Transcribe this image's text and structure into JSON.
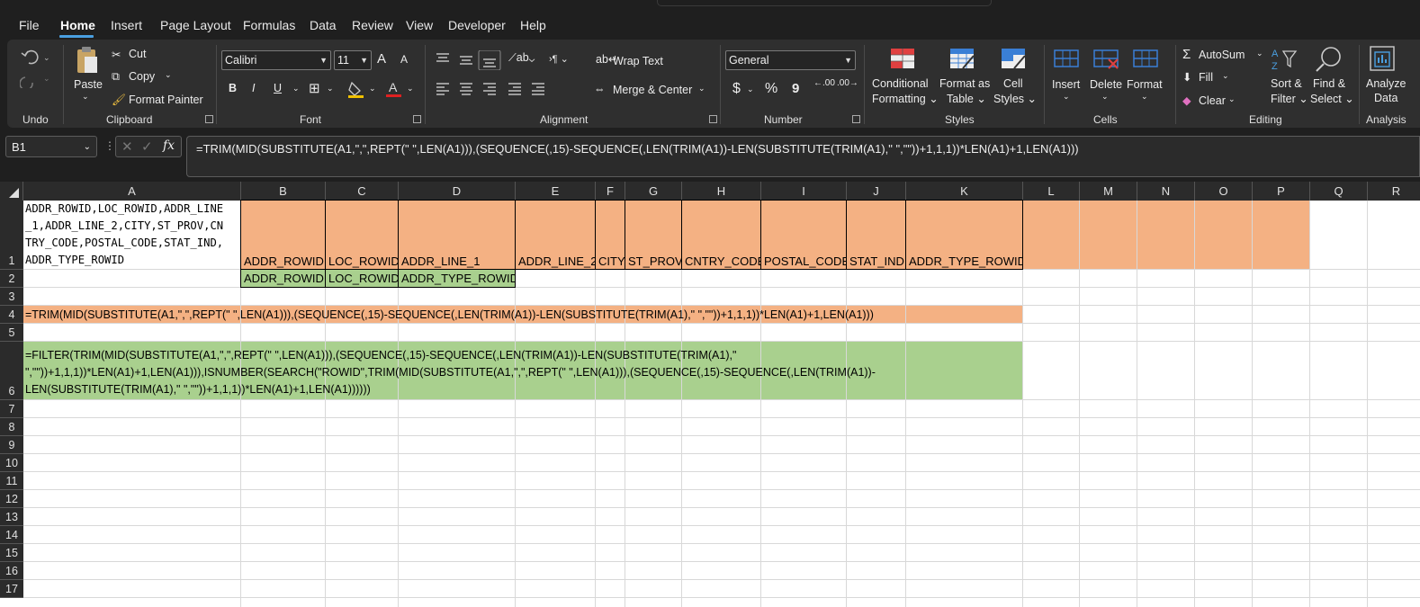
{
  "menu": {
    "items": [
      "File",
      "Home",
      "Insert",
      "Page Layout",
      "Formulas",
      "Data",
      "Review",
      "View",
      "Developer",
      "Help"
    ],
    "active": "Home"
  },
  "ribbon": {
    "undo": {
      "group": "Undo"
    },
    "clipboard": {
      "group": "Clipboard",
      "paste": "Paste",
      "cut": "Cut",
      "copy": "Copy",
      "format_painter": "Format Painter"
    },
    "font": {
      "group": "Font",
      "name": "Calibri",
      "size": "11",
      "grow": "A",
      "shrink": "A",
      "bold": "B",
      "italic": "I",
      "underline": "U"
    },
    "alignment": {
      "group": "Alignment",
      "wrap": "Wrap Text",
      "merge": "Merge & Center"
    },
    "number": {
      "group": "Number",
      "format": "General",
      "currency": "$",
      "percent": "%",
      "comma": "9",
      "inc": ".00",
      "dec": ".00"
    },
    "styles": {
      "group": "Styles",
      "conditional_1": "Conditional",
      "conditional_2": "Formatting",
      "format_table_1": "Format as",
      "format_table_2": "Table",
      "cell_styles_1": "Cell",
      "cell_styles_2": "Styles"
    },
    "cells": {
      "group": "Cells",
      "insert": "Insert",
      "delete": "Delete",
      "format": "Format"
    },
    "editing": {
      "group": "Editing",
      "autosum": "AutoSum",
      "fill": "Fill",
      "clear": "Clear",
      "sort_1": "Sort &",
      "sort_2": "Filter",
      "find_1": "Find &",
      "find_2": "Select"
    },
    "analysis": {
      "group": "Analysis",
      "analyze_1": "Analyze",
      "analyze_2": "Data"
    }
  },
  "formula_bar": {
    "name_box": "B1",
    "fx": "fx",
    "formula": "=TRIM(MID(SUBSTITUTE(A1,\",\",REPT(\" \",LEN(A1))),(SEQUENCE(,15)-SEQUENCE(,LEN(TRIM(A1))-LEN(SUBSTITUTE(TRIM(A1),\" \",\"\"))+1,1,1))*LEN(A1)+1,LEN(A1)))"
  },
  "columns": [
    "A",
    "B",
    "C",
    "D",
    "E",
    "F",
    "G",
    "H",
    "I",
    "J",
    "K",
    "L",
    "M",
    "N",
    "O",
    "P",
    "Q",
    "R"
  ],
  "rows": [
    "1",
    "2",
    "3",
    "4",
    "5",
    "6",
    "7",
    "8",
    "9",
    "10",
    "11",
    "12",
    "13",
    "14",
    "15",
    "16",
    "17"
  ],
  "cells": {
    "a1_lines": [
      "ADDR_ROWID,LOC_ROWID,ADDR_LINE",
      "_1,ADDR_LINE_2,CITY,ST_PROV,CN",
      "TRY_CODE,POSTAL_CODE,STAT_IND,",
      "ADDR_TYPE_ROWID"
    ],
    "row1": [
      "ADDR_ROWID",
      "LOC_ROWID",
      "ADDR_LINE_1",
      "ADDR_LINE_2",
      "CITY",
      "ST_PROV",
      "CNTRY_CODE",
      "POSTAL_CODE",
      "STAT_IND",
      "ADDR_TYPE_ROWID"
    ],
    "row2": [
      "ADDR_ROWID",
      "LOC_ROWID",
      "ADDR_TYPE_ROWID"
    ],
    "a4": "=TRIM(MID(SUBSTITUTE(A1,\",\",REPT(\" \",LEN(A1))),(SEQUENCE(,15)-SEQUENCE(,LEN(TRIM(A1))-LEN(SUBSTITUTE(TRIM(A1),\" \",\"\"))+1,1,1))*LEN(A1)+1,LEN(A1)))",
    "a6_lines": [
      "=FILTER(TRIM(MID(SUBSTITUTE(A1,\",\",REPT(\" \",LEN(A1))),(SEQUENCE(,15)-SEQUENCE(,LEN(TRIM(A1))-LEN(SUBSTITUTE(TRIM(A1),\"",
      "\",\"\"))+1,1,1))*LEN(A1)+1,LEN(A1))),ISNUMBER(SEARCH(\"ROWID\",TRIM(MID(SUBSTITUTE(A1,\",\",REPT(\" \",LEN(A1))),(SEQUENCE(,15)-SEQUENCE(,LEN(TRIM(A1))-",
      "LEN(SUBSTITUTE(TRIM(A1),\" \",\"\"))+1,1,1))*LEN(A1)+1,LEN(A1))))))"
    ]
  },
  "colors": {
    "orange": "#f4b183",
    "green": "#a9d08e",
    "accent": "#4a9fe0"
  }
}
